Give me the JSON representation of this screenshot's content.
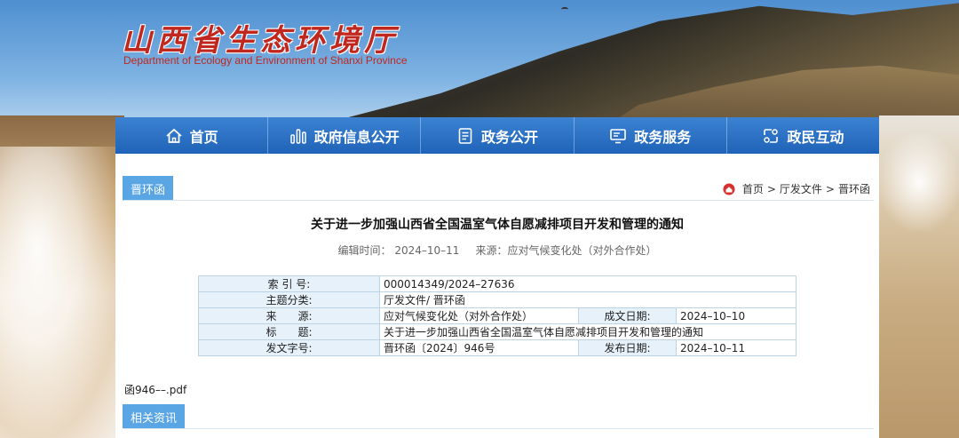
{
  "site": {
    "title": "山西省生态环境厅",
    "subtitle": "Department of Ecology and Environment of Shanxi Province"
  },
  "nav": [
    {
      "label": "首页",
      "icon": "home-icon"
    },
    {
      "label": "政府信息公开",
      "icon": "chart-icon"
    },
    {
      "label": "政务公开",
      "icon": "document-icon"
    },
    {
      "label": "政务服务",
      "icon": "monitor-icon"
    },
    {
      "label": "政民互动",
      "icon": "interaction-icon"
    }
  ],
  "section_tab": "晋环函",
  "breadcrumb": {
    "icon": "home-icon",
    "items": [
      "首页",
      "厅发文件",
      "晋环函"
    ],
    "separator": ">"
  },
  "document": {
    "title": "关于进一步加强山西省全国温室气体自愿减排项目开发和管理的通知",
    "edit_time": "编辑时间：  2024–10–11",
    "source": "来源：应对气候变化处（对外合作处）"
  },
  "info_table": {
    "index_label": "索 引 号:",
    "index_value": "000014349/2024–27636",
    "topic_label": "主题分类:",
    "topic_value": "厅发文件/ 晋环函",
    "source_label": "来　　源:",
    "source_value": "应对气候变化处（对外合作处）",
    "created_label": "成文日期:",
    "created_value": "2024–10–10",
    "title_label": "标　　题:",
    "title_value": "关于进一步加强山西省全国温室气体自愿减排项目开发和管理的通知",
    "docno_label": "发文字号:",
    "docno_value": "晋环函〔2024〕946号",
    "published_label": "发布日期:",
    "published_value": "2024–10–11"
  },
  "attachment": "函946––.pdf",
  "related_tab": "相关资讯",
  "colors": {
    "nav_blue": "#1f63b8",
    "tab_blue": "#5aa5e4",
    "title_red": "#c0271f",
    "table_key_bg": "#e6f1fa"
  }
}
